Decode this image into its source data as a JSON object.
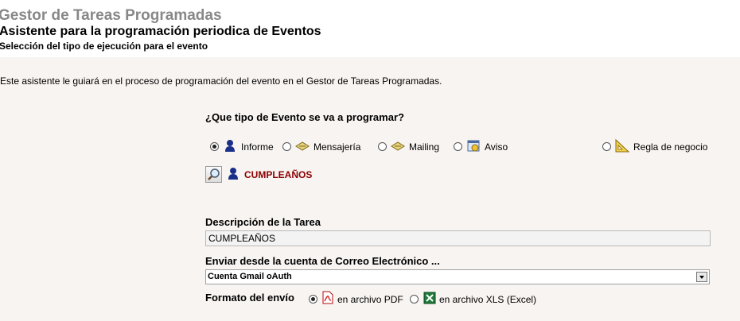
{
  "header": {
    "app_title": "Gestor de Tareas Programadas",
    "wizard_title": "Asistente para la programación periodica de Eventos",
    "step_title": "Selección del tipo de ejecución para el evento"
  },
  "intro_text": "Este asistente le guiará en el proceso de programación del evento en el Gestor de Tareas Programadas.",
  "event_type": {
    "question": "¿Que tipo de Evento se va a programar?",
    "options": [
      {
        "label": "Informe",
        "icon": "user-icon",
        "checked": true
      },
      {
        "label": "Mensajería",
        "icon": "message-icon",
        "checked": false
      },
      {
        "label": "Mailing",
        "icon": "mailing-icon",
        "checked": false
      },
      {
        "label": "Aviso",
        "icon": "alert-icon",
        "checked": false
      },
      {
        "label": "Regla de negocio",
        "icon": "ruler-icon",
        "checked": false
      }
    ],
    "selected_event_name": "CUMPLEAÑOS"
  },
  "task_description": {
    "label": "Descripción de la Tarea",
    "value": "CUMPLEAÑOS"
  },
  "email_account": {
    "label": "Enviar desde la cuenta de Correo Electrónico ...",
    "value": "Cuenta Gmail oAuth"
  },
  "send_format": {
    "label": "Formato del envío",
    "options": [
      {
        "label": "en archivo PDF",
        "icon": "pdf-icon",
        "checked": true
      },
      {
        "label": "en archivo XLS (Excel)",
        "icon": "excel-icon",
        "checked": false
      }
    ]
  },
  "colors": {
    "selected_event": "#8b0000",
    "content_background": "#f8f4f1"
  }
}
